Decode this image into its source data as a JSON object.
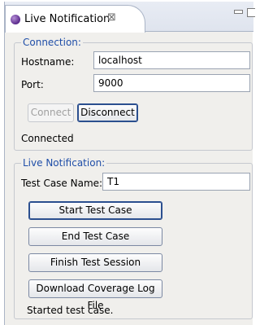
{
  "view": {
    "tab_label": "Live Notification",
    "tab_close_glyph": "⊠"
  },
  "connection": {
    "group_title": "Connection:",
    "hostname_label": "Hostname:",
    "hostname_value": "localhost",
    "port_label": "Port:",
    "port_value": "9000",
    "connect_label": "Connect",
    "disconnect_label": "Disconnect",
    "status": "Connected"
  },
  "live_notification": {
    "group_title": "Live Notification:",
    "test_case_label": "Test Case Name:",
    "test_case_value": "T1",
    "buttons": {
      "start": "Start Test Case",
      "end": "End Test Case",
      "finish": "Finish Test Session",
      "download": "Download Coverage Log File"
    },
    "status": "Started test case."
  },
  "icons": {
    "tab": "eclipse-view-icon",
    "close": "close-icon",
    "minimize": "minimize-icon",
    "maximize": "maximize-icon"
  }
}
